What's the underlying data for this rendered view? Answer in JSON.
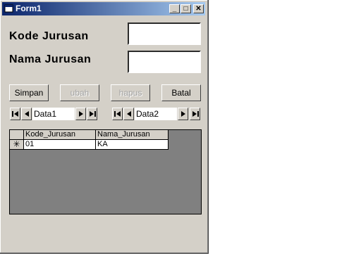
{
  "window": {
    "title": "Form1",
    "minimize": "_",
    "maximize": "□",
    "close": "✕"
  },
  "form": {
    "label_kode": "Kode Jurusan",
    "label_nama": "Nama Jurusan",
    "kode_value": "",
    "nama_value": ""
  },
  "buttons": {
    "simpan": "Simpan",
    "ubah": "ubah",
    "hapus": "hapus",
    "batal": "Batal"
  },
  "data_controls": [
    {
      "caption": "Data1"
    },
    {
      "caption": "Data2"
    }
  ],
  "grid": {
    "columns": [
      "Kode_Jurusan",
      "Nama_Jurusan"
    ],
    "row_marker": "✳",
    "rows": [
      [
        "01",
        "KA"
      ]
    ]
  }
}
